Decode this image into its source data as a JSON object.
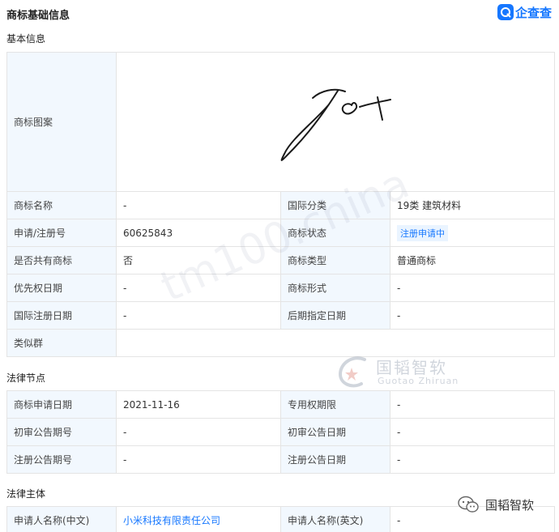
{
  "header": {
    "title": "商标基础信息",
    "logo_text": "企查查"
  },
  "basic_info": {
    "title": "基本信息",
    "image_label": "商标图案",
    "rows": [
      [
        {
          "label": "商标名称",
          "value": "-"
        },
        {
          "label": "国际分类",
          "value": "19类 建筑材料"
        }
      ],
      [
        {
          "label": "申请/注册号",
          "value": "60625843"
        },
        {
          "label": "商标状态",
          "value": "注册申请中"
        }
      ],
      [
        {
          "label": "是否共有商标",
          "value": "否"
        },
        {
          "label": "商标类型",
          "value": "普通商标"
        }
      ],
      [
        {
          "label": "优先权日期",
          "value": "-"
        },
        {
          "label": "商标形式",
          "value": "-"
        }
      ],
      [
        {
          "label": "国际注册日期",
          "value": "-"
        },
        {
          "label": "后期指定日期",
          "value": "-"
        }
      ]
    ],
    "similar_group_label": "类似群",
    "similar_group_value": ""
  },
  "legal_nodes": {
    "title": "法律节点",
    "rows": [
      [
        {
          "label": "商标申请日期",
          "value": "2021-11-16"
        },
        {
          "label": "专用权期限",
          "value": "-"
        }
      ],
      [
        {
          "label": "初审公告期号",
          "value": "-"
        },
        {
          "label": "初审公告日期",
          "value": "-"
        }
      ],
      [
        {
          "label": "注册公告期号",
          "value": "-"
        },
        {
          "label": "注册公告日期",
          "value": "-"
        }
      ]
    ]
  },
  "legal_subject": {
    "title": "法律主体",
    "rows": [
      [
        {
          "label": "申请人名称(中文)",
          "value": "小米科技有限责任公司"
        },
        {
          "label": "申请人名称(英文)",
          "value": "-"
        }
      ]
    ]
  },
  "watermark": {
    "text": "tm100.china",
    "logo_cn": "国韬智软",
    "logo_en": "Guotao Zhiruan"
  },
  "wechat": {
    "account_name": "国韬智软"
  },
  "colors": {
    "accent": "#1677ff",
    "label_bg": "#f2f8fe",
    "border": "#e4e4e4"
  }
}
